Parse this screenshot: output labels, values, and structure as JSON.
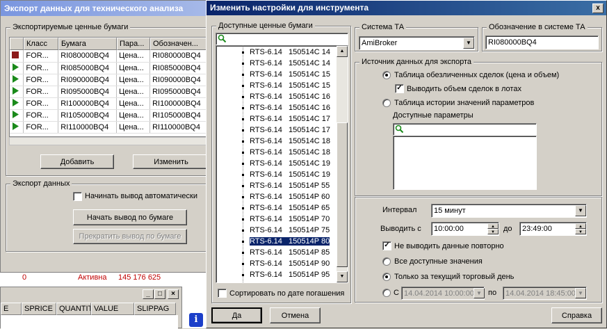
{
  "export_window": {
    "title": "Экспорт данных для технического анализа",
    "securities_group": "Экспортируемые ценные бумаги",
    "columns": [
      "Класс",
      "Бумага",
      "Пара...",
      "Обозначен..."
    ],
    "rows": [
      {
        "cls": "FOR...",
        "security": "RI080000BQ4",
        "param": "Цена...",
        "symbol": "RI080000BQ4",
        "status": "stopped"
      },
      {
        "cls": "FOR...",
        "security": "RI085000BQ4",
        "param": "Цена...",
        "symbol": "RI085000BQ4",
        "status": "running"
      },
      {
        "cls": "FOR...",
        "security": "RI090000BQ4",
        "param": "Цена...",
        "symbol": "RI090000BQ4",
        "status": "running"
      },
      {
        "cls": "FOR...",
        "security": "RI095000BQ4",
        "param": "Цена...",
        "symbol": "RI095000BQ4",
        "status": "running"
      },
      {
        "cls": "FOR...",
        "security": "RI100000BQ4",
        "param": "Цена...",
        "symbol": "RI100000BQ4",
        "status": "running"
      },
      {
        "cls": "FOR...",
        "security": "RI105000BQ4",
        "param": "Цена...",
        "symbol": "RI105000BQ4",
        "status": "running"
      },
      {
        "cls": "FOR...",
        "security": "RI110000BQ4",
        "param": "Цена...",
        "symbol": "RI110000BQ4",
        "status": "running"
      }
    ],
    "add_button": "Добавить",
    "edit_button": "Изменить",
    "export_group": "Экспорт данных",
    "auto_start_label": "Начинать вывод автоматически",
    "start_button": "Начать вывод по бумаге",
    "stop_button": "Прекратить вывод по бумаге"
  },
  "background": {
    "row_status": "Активна",
    "row_value": "145 176 625",
    "row_num": "0",
    "columns": [
      "E",
      "SPRICE",
      "QUANTIT",
      "VALUE",
      "SLIPPAG"
    ]
  },
  "dialog": {
    "title": "Изменить настройки для инструмента",
    "close_label": "x",
    "available_group": "Доступные ценные бумаги",
    "search_value": "",
    "securities": [
      {
        "name": "RTS-6.14",
        "code": "150514C 14"
      },
      {
        "name": "RTS-6.14",
        "code": "150514C 14"
      },
      {
        "name": "RTS-6.14",
        "code": "150514C 15"
      },
      {
        "name": "RTS-6.14",
        "code": "150514C 15"
      },
      {
        "name": "RTS-6.14",
        "code": "150514C 16"
      },
      {
        "name": "RTS-6.14",
        "code": "150514C 16"
      },
      {
        "name": "RTS-6.14",
        "code": "150514C 17"
      },
      {
        "name": "RTS-6.14",
        "code": "150514C 17"
      },
      {
        "name": "RTS-6.14",
        "code": "150514C 18"
      },
      {
        "name": "RTS-6.14",
        "code": "150514C 18"
      },
      {
        "name": "RTS-6.14",
        "code": "150514C 19"
      },
      {
        "name": "RTS-6.14",
        "code": "150514C 19"
      },
      {
        "name": "RTS-6.14",
        "code": "150514P 55"
      },
      {
        "name": "RTS-6.14",
        "code": "150514P 60"
      },
      {
        "name": "RTS-6.14",
        "code": "150514P 65"
      },
      {
        "name": "RTS-6.14",
        "code": "150514P 70"
      },
      {
        "name": "RTS-6.14",
        "code": "150514P 75"
      },
      {
        "name": "RTS-6.14",
        "code": "150514P 80"
      },
      {
        "name": "RTS-6.14",
        "code": "150514P 85"
      },
      {
        "name": "RTS-6.14",
        "code": "150514P 90"
      },
      {
        "name": "RTS-6.14",
        "code": "150514P 95"
      }
    ],
    "selected_index": 17,
    "sort_label": "Сортировать по дате погашения",
    "ta_system_group": "Система ТА",
    "ta_system_value": "AmiBroker",
    "ta_symbol_group": "Обозначение в системе ТА",
    "ta_symbol_value": "RI080000BQ4",
    "source_group": "Источник данных для экспорта",
    "source_trades_label": "Таблица обезличенных сделок (цена и объем)",
    "lots_label": "Выводить объем  сделок в лотах",
    "source_history_label": "Таблица истории значений параметров",
    "available_params_label": "Доступные параметры",
    "interval_label": "Интервал",
    "interval_value": "15 минут",
    "from_label": "Выводить с",
    "from_time": "10:00:00",
    "to_label": "до",
    "to_time": "23:49:00",
    "no_repeat_label": "Не выводить данные повторно",
    "all_values_label": "Все доступные значения",
    "today_only_label": "Только за текущий торговый день",
    "range_from_label": "С",
    "range_from_value": "14.04.2014 10:00:00",
    "range_to_label": "по",
    "range_to_value": "14.04.2014 18:45:00",
    "ok_button": "Да",
    "cancel_button": "Отмена",
    "help_button": "Справка"
  },
  "colors": {
    "running": "#1a8a1a",
    "stopped": "#8b1a1a",
    "selection": "#0a246a"
  }
}
